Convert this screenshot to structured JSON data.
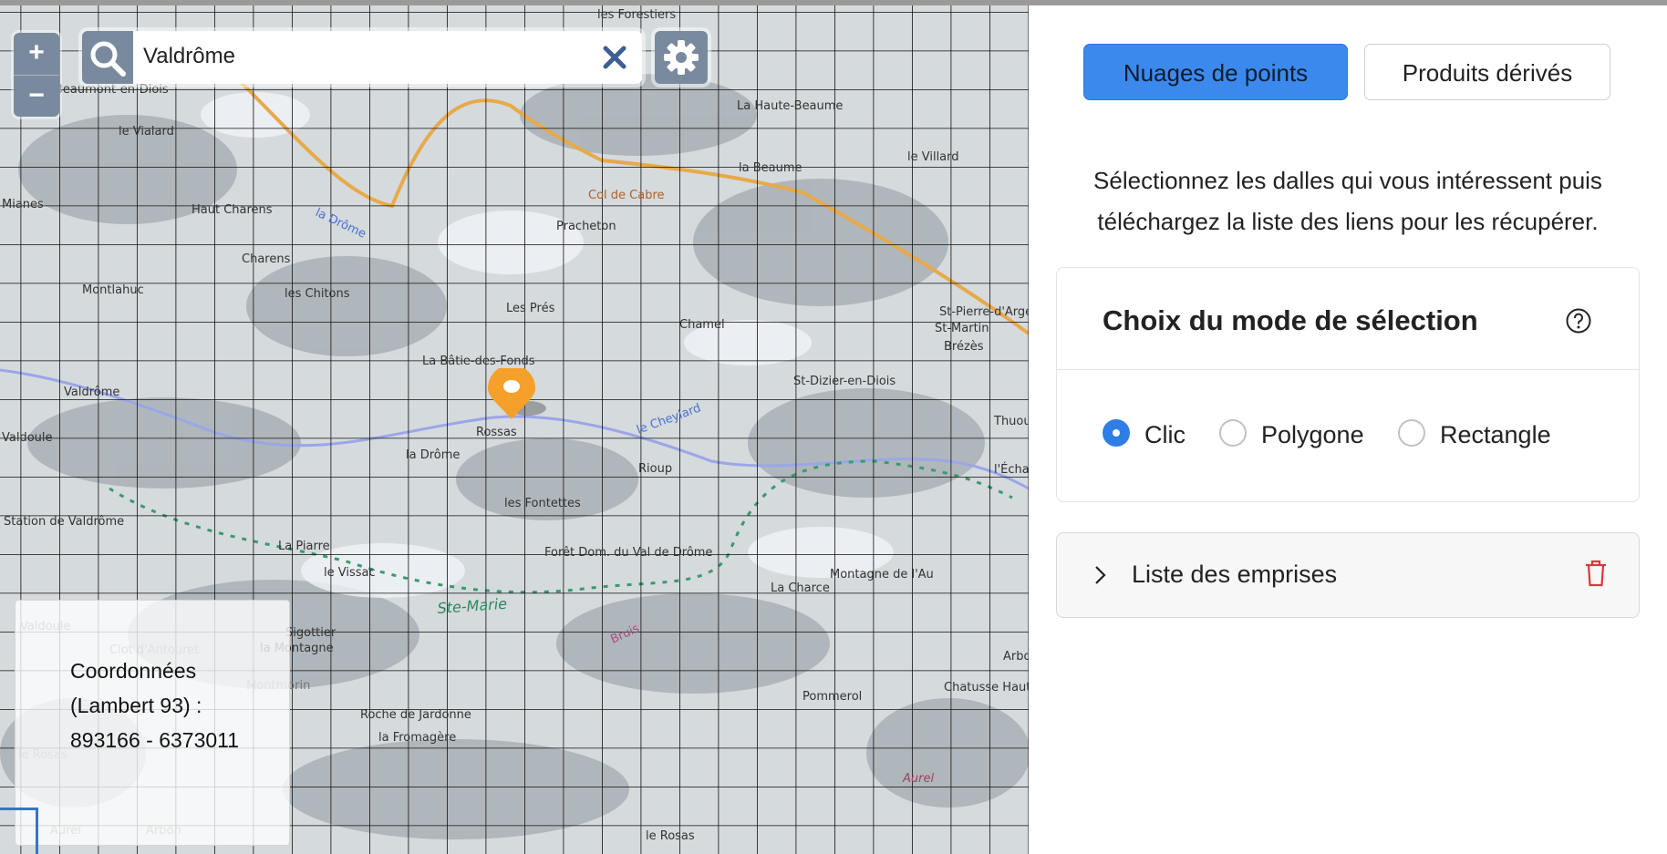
{
  "search": {
    "value": "Valdrôme"
  },
  "zoom": {
    "in_label": "+",
    "out_label": "−"
  },
  "coordinates": {
    "text": "Coordonnées (Lambert 93) : 893166 - 6373011"
  },
  "map_labels": [
    "les Forestiers",
    "Beaumont-en-Diois",
    "le Vialard",
    "La Haute-Beaume",
    "la Beaume",
    "le Villard",
    "Col de Cabre",
    "Haut Charens",
    "la Drôme",
    "Pracheton",
    "Charens",
    "Montlahuc",
    "les Chitons",
    "Les Prés",
    "Chamel",
    "St-Pierre-d'Argençon",
    "St-Martin",
    "Brézès",
    "La Bâtie-des-Fonds",
    "St-Dizier-en-Diois",
    "Valdrôme",
    "Rossas",
    "la Drôme",
    "le Cheylard",
    "Rioup",
    "Thuou",
    "l'Échaillon",
    "Valdoule",
    "Mianes",
    "les Fontettes",
    "Station de Valdrôme",
    "La Piarre",
    "le Vissac",
    "Forêt Dom. du Val de Drôme",
    "Montagne de l'Au",
    "La Charce",
    "Ste-Marie",
    "Bruis",
    "Valdoule",
    "Clot d'Antouret",
    "Sigottier",
    "la Montagne",
    "Montmorin",
    "Chatusse Haute",
    "Pommerol",
    "Roche de Jardonne",
    "la Fromagère",
    "le Rosas",
    "Aurel",
    "Arbon"
  ],
  "panel": {
    "tabs": [
      {
        "label": "Nuages de points",
        "active": true
      },
      {
        "label": "Produits dérivés",
        "active": false
      }
    ],
    "intro": "Sélectionnez les dalles qui vous intéressent puis téléchargez la liste des liens pour les récupérer.",
    "selection": {
      "title": "Choix du mode de sélection",
      "options": [
        {
          "label": "Clic",
          "checked": true
        },
        {
          "label": "Polygone",
          "checked": false
        },
        {
          "label": "Rectangle",
          "checked": false
        }
      ]
    },
    "extents": {
      "label": "Liste des emprises"
    }
  },
  "colors": {
    "primary": "#3b89ec",
    "map_control": "#7a8a9e",
    "pin": "#f5a02a",
    "danger": "#d9383a"
  }
}
